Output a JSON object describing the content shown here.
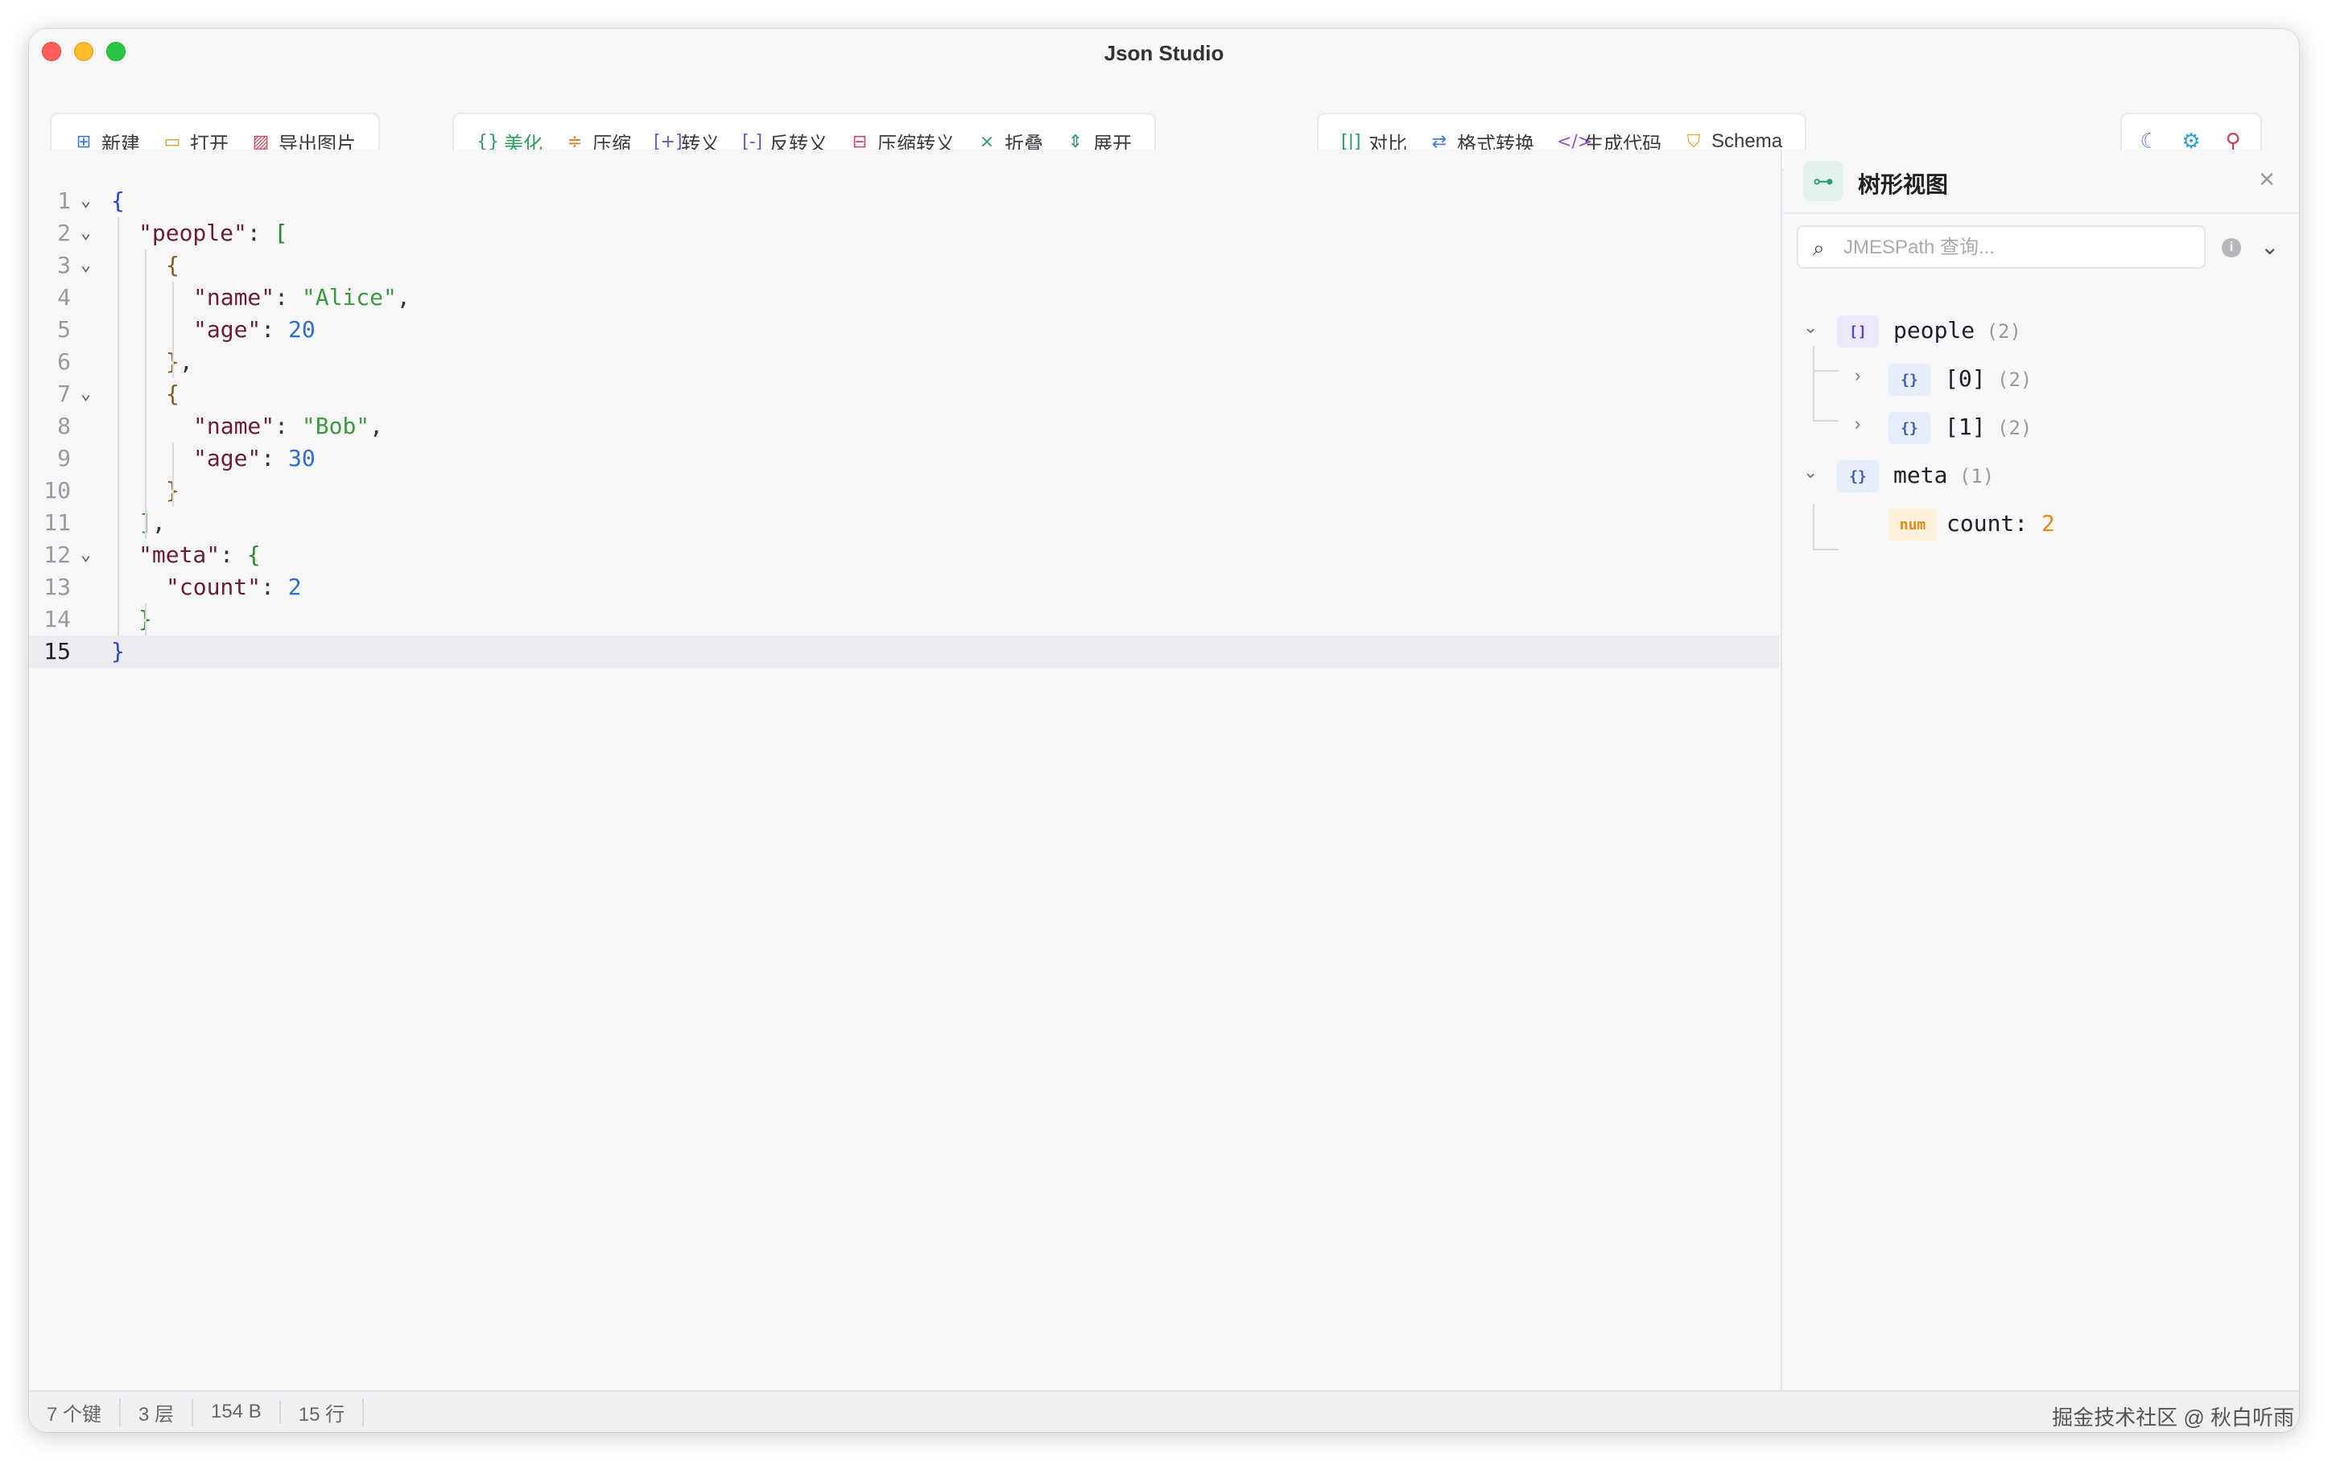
{
  "window": {
    "title": "Json Studio"
  },
  "toolbar": {
    "file": [
      {
        "label": "新建",
        "icon": "new-file-icon",
        "glyph": "⊞",
        "color": "#3b7be0"
      },
      {
        "label": "打开",
        "icon": "folder-icon",
        "glyph": "▭",
        "color": "#d89a1e"
      },
      {
        "label": "导出图片",
        "icon": "image-icon",
        "glyph": "▨",
        "color": "#d0435a"
      }
    ],
    "format": [
      {
        "label": "美化",
        "icon": "braces-icon",
        "glyph": "{}",
        "color": "#2f9d62",
        "accent": true
      },
      {
        "label": "压缩",
        "icon": "compress-icon",
        "glyph": "≑",
        "color": "#e07a24"
      },
      {
        "label": "转义",
        "icon": "escape-icon",
        "glyph": "[+]",
        "color": "#6a55c9"
      },
      {
        "label": "反转义",
        "icon": "unescape-icon",
        "glyph": "[-]",
        "color": "#6a55c9"
      },
      {
        "label": "压缩转义",
        "icon": "compress-escape-icon",
        "glyph": "⊟",
        "color": "#d0435a"
      },
      {
        "label": "折叠",
        "icon": "collapse-icon",
        "glyph": "⨯",
        "color": "#2f9d62"
      },
      {
        "label": "展开",
        "icon": "expand-icon",
        "glyph": "⇕",
        "color": "#2f9d62"
      }
    ],
    "tools": [
      {
        "label": "对比",
        "icon": "diff-icon",
        "glyph": "[|]",
        "color": "#2f9d62"
      },
      {
        "label": "格式转换",
        "icon": "convert-icon",
        "glyph": "⇄",
        "color": "#3b7be0"
      },
      {
        "label": "生成代码",
        "icon": "code-icon",
        "glyph": "</>",
        "color": "#9b4fd0"
      },
      {
        "label": "Schema",
        "icon": "schema-shield-icon",
        "glyph": "⛉",
        "color": "#e3a21a"
      }
    ],
    "right": [
      {
        "icon": "moon-icon",
        "glyph": "☾",
        "color": "#6a7de0"
      },
      {
        "icon": "settings-gear-icon",
        "glyph": "⚙",
        "color": "#2c9fd8"
      },
      {
        "icon": "pin-icon",
        "glyph": "⚲",
        "color": "#d0435a"
      }
    ]
  },
  "editor": {
    "active_line": 15,
    "lines": [
      {
        "n": "1",
        "fold": true,
        "indent": 0,
        "tokens": [
          [
            "b1",
            "{"
          ]
        ]
      },
      {
        "n": "2",
        "fold": true,
        "indent": 1,
        "tokens": [
          [
            "k",
            "\"people\""
          ],
          [
            "p",
            ": "
          ],
          [
            "b2",
            "["
          ]
        ]
      },
      {
        "n": "3",
        "fold": true,
        "indent": 2,
        "tokens": [
          [
            "b3",
            "{"
          ]
        ]
      },
      {
        "n": "4",
        "fold": false,
        "indent": 3,
        "tokens": [
          [
            "k",
            "\"name\""
          ],
          [
            "p",
            ": "
          ],
          [
            "s",
            "\"Alice\""
          ],
          [
            "p",
            ","
          ]
        ]
      },
      {
        "n": "5",
        "fold": false,
        "indent": 3,
        "tokens": [
          [
            "k",
            "\"age\""
          ],
          [
            "p",
            ": "
          ],
          [
            "n",
            "20"
          ]
        ]
      },
      {
        "n": "6",
        "fold": false,
        "indent": 2,
        "tokens": [
          [
            "b3",
            "}"
          ],
          [
            "p",
            ","
          ]
        ]
      },
      {
        "n": "7",
        "fold": true,
        "indent": 2,
        "tokens": [
          [
            "b3",
            "{"
          ]
        ]
      },
      {
        "n": "8",
        "fold": false,
        "indent": 3,
        "tokens": [
          [
            "k",
            "\"name\""
          ],
          [
            "p",
            ": "
          ],
          [
            "s",
            "\"Bob\""
          ],
          [
            "p",
            ","
          ]
        ]
      },
      {
        "n": "9",
        "fold": false,
        "indent": 3,
        "tokens": [
          [
            "k",
            "\"age\""
          ],
          [
            "p",
            ": "
          ],
          [
            "n",
            "30"
          ]
        ]
      },
      {
        "n": "10",
        "fold": false,
        "indent": 2,
        "tokens": [
          [
            "b3",
            "}"
          ]
        ]
      },
      {
        "n": "11",
        "fold": false,
        "indent": 1,
        "tokens": [
          [
            "b2",
            "]"
          ],
          [
            "p",
            ","
          ]
        ]
      },
      {
        "n": "12",
        "fold": true,
        "indent": 1,
        "tokens": [
          [
            "k",
            "\"meta\""
          ],
          [
            "p",
            ": "
          ],
          [
            "b2",
            "{"
          ]
        ]
      },
      {
        "n": "13",
        "fold": false,
        "indent": 2,
        "tokens": [
          [
            "k",
            "\"count\""
          ],
          [
            "p",
            ": "
          ],
          [
            "n",
            "2"
          ]
        ]
      },
      {
        "n": "14",
        "fold": false,
        "indent": 1,
        "tokens": [
          [
            "b2",
            "}"
          ]
        ]
      },
      {
        "n": "15",
        "fold": false,
        "indent": 0,
        "tokens": [
          [
            "b1",
            "}"
          ]
        ]
      }
    ]
  },
  "tree_panel": {
    "title": "树形视图",
    "search_placeholder": "JMESPath 查询...",
    "nodes": [
      {
        "level": 0,
        "chevron": "⌄",
        "badge": "[]",
        "badge_type": "arr",
        "label": "people",
        "count": "(2)"
      },
      {
        "level": 1,
        "chevron": "›",
        "badge": "{}",
        "badge_type": "obj",
        "label": "[0]",
        "count": "(2)"
      },
      {
        "level": 1,
        "chevron": "›",
        "badge": "{}",
        "badge_type": "obj",
        "label": "[1]",
        "count": "(2)"
      },
      {
        "level": 0,
        "chevron": "⌄",
        "badge": "{}",
        "badge_type": "obj",
        "label": "meta",
        "count": "(1)"
      },
      {
        "level": 1,
        "chevron": "",
        "badge": "num",
        "badge_type": "num",
        "label": "count:",
        "value": "2"
      }
    ]
  },
  "status": {
    "keys": "7 个键",
    "depth": "3 层",
    "size": "154 B",
    "lines": "15 行",
    "watermark": "掘金技术社区 @ 秋白听雨"
  }
}
